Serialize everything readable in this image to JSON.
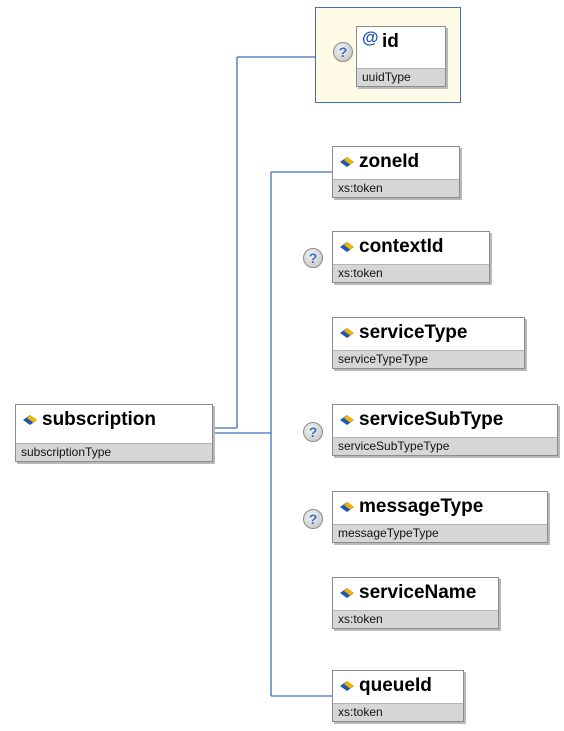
{
  "root": {
    "name": "subscription",
    "type": "subscriptionType"
  },
  "attribute": {
    "name": "id",
    "type": "uuidType",
    "optional": true
  },
  "elements": [
    {
      "name": "zoneId",
      "type": "xs:token",
      "optional": false
    },
    {
      "name": "contextId",
      "type": "xs:token",
      "optional": true
    },
    {
      "name": "serviceType",
      "type": "serviceTypeType",
      "optional": false
    },
    {
      "name": "serviceSubType",
      "type": "serviceSubTypeType",
      "optional": true
    },
    {
      "name": "messageType",
      "type": "messageTypeType",
      "optional": true
    },
    {
      "name": "serviceName",
      "type": "xs:token",
      "optional": false
    },
    {
      "name": "queueId",
      "type": "xs:token",
      "optional": false
    }
  ],
  "icons": {
    "element": "element-diamond-icon",
    "attribute": "at-sign-icon",
    "optional": "question-mark-icon"
  },
  "colors": {
    "connector": "#3e6fb4",
    "attribute_panel": "#fffbe6",
    "type_band": "#d6d6d6",
    "icon_blue": "#1d57b0",
    "icon_gold": "#f0b400"
  }
}
